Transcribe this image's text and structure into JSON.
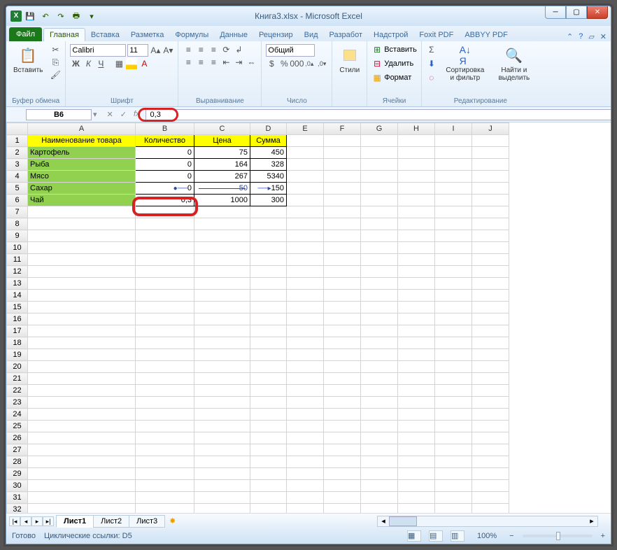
{
  "window": {
    "title": "Книга3.xlsx - Microsoft Excel"
  },
  "qat": {
    "excel_logo": "X"
  },
  "tabs": {
    "file": "Файл",
    "items": [
      "Главная",
      "Вставка",
      "Разметка",
      "Формулы",
      "Данные",
      "Рецензир",
      "Вид",
      "Разработ",
      "Надстрой",
      "Foxit PDF",
      "ABBYY PDF"
    ],
    "active": 0
  },
  "ribbon": {
    "groups": {
      "clipboard": {
        "name": "Буфер обмена",
        "paste": "Вставить"
      },
      "font": {
        "name": "Шрифт",
        "font": "Calibri",
        "size": "11"
      },
      "align": {
        "name": "Выравнивание"
      },
      "number": {
        "name": "Число",
        "format": "Общий"
      },
      "styles": {
        "name": "",
        "btn": "Стили"
      },
      "cells": {
        "name": "Ячейки",
        "insert": "Вставить",
        "delete": "Удалить",
        "format": "Формат"
      },
      "editing": {
        "name": "Редактирование",
        "sort": "Сортировка и фильтр",
        "find": "Найти и выделить"
      }
    }
  },
  "namebox": "B6",
  "formula_value": "0,3",
  "columns": [
    "A",
    "B",
    "C",
    "D",
    "E",
    "F",
    "G",
    "H",
    "I",
    "J"
  ],
  "table": {
    "headers": [
      "Наименование товара",
      "Количество",
      "Цена",
      "Сумма"
    ],
    "rows": [
      {
        "name": "Картофель",
        "qty": "0",
        "price": "75",
        "sum": "450"
      },
      {
        "name": "Рыба",
        "qty": "0",
        "price": "164",
        "sum": "328"
      },
      {
        "name": "Мясо",
        "qty": "0",
        "price": "267",
        "sum": "5340"
      },
      {
        "name": "Сахар",
        "qty": "0",
        "price": "50",
        "sum": "150"
      },
      {
        "name": "Чай",
        "qty": "0,3",
        "price": "1000",
        "sum": "300"
      }
    ],
    "circular_row_index": 3
  },
  "row_count": 32,
  "sheets": {
    "items": [
      "Лист1",
      "Лист2",
      "Лист3"
    ],
    "active": 0
  },
  "status": {
    "ready": "Готово",
    "circular": "Циклические ссылки: D5",
    "zoom": "100%"
  }
}
